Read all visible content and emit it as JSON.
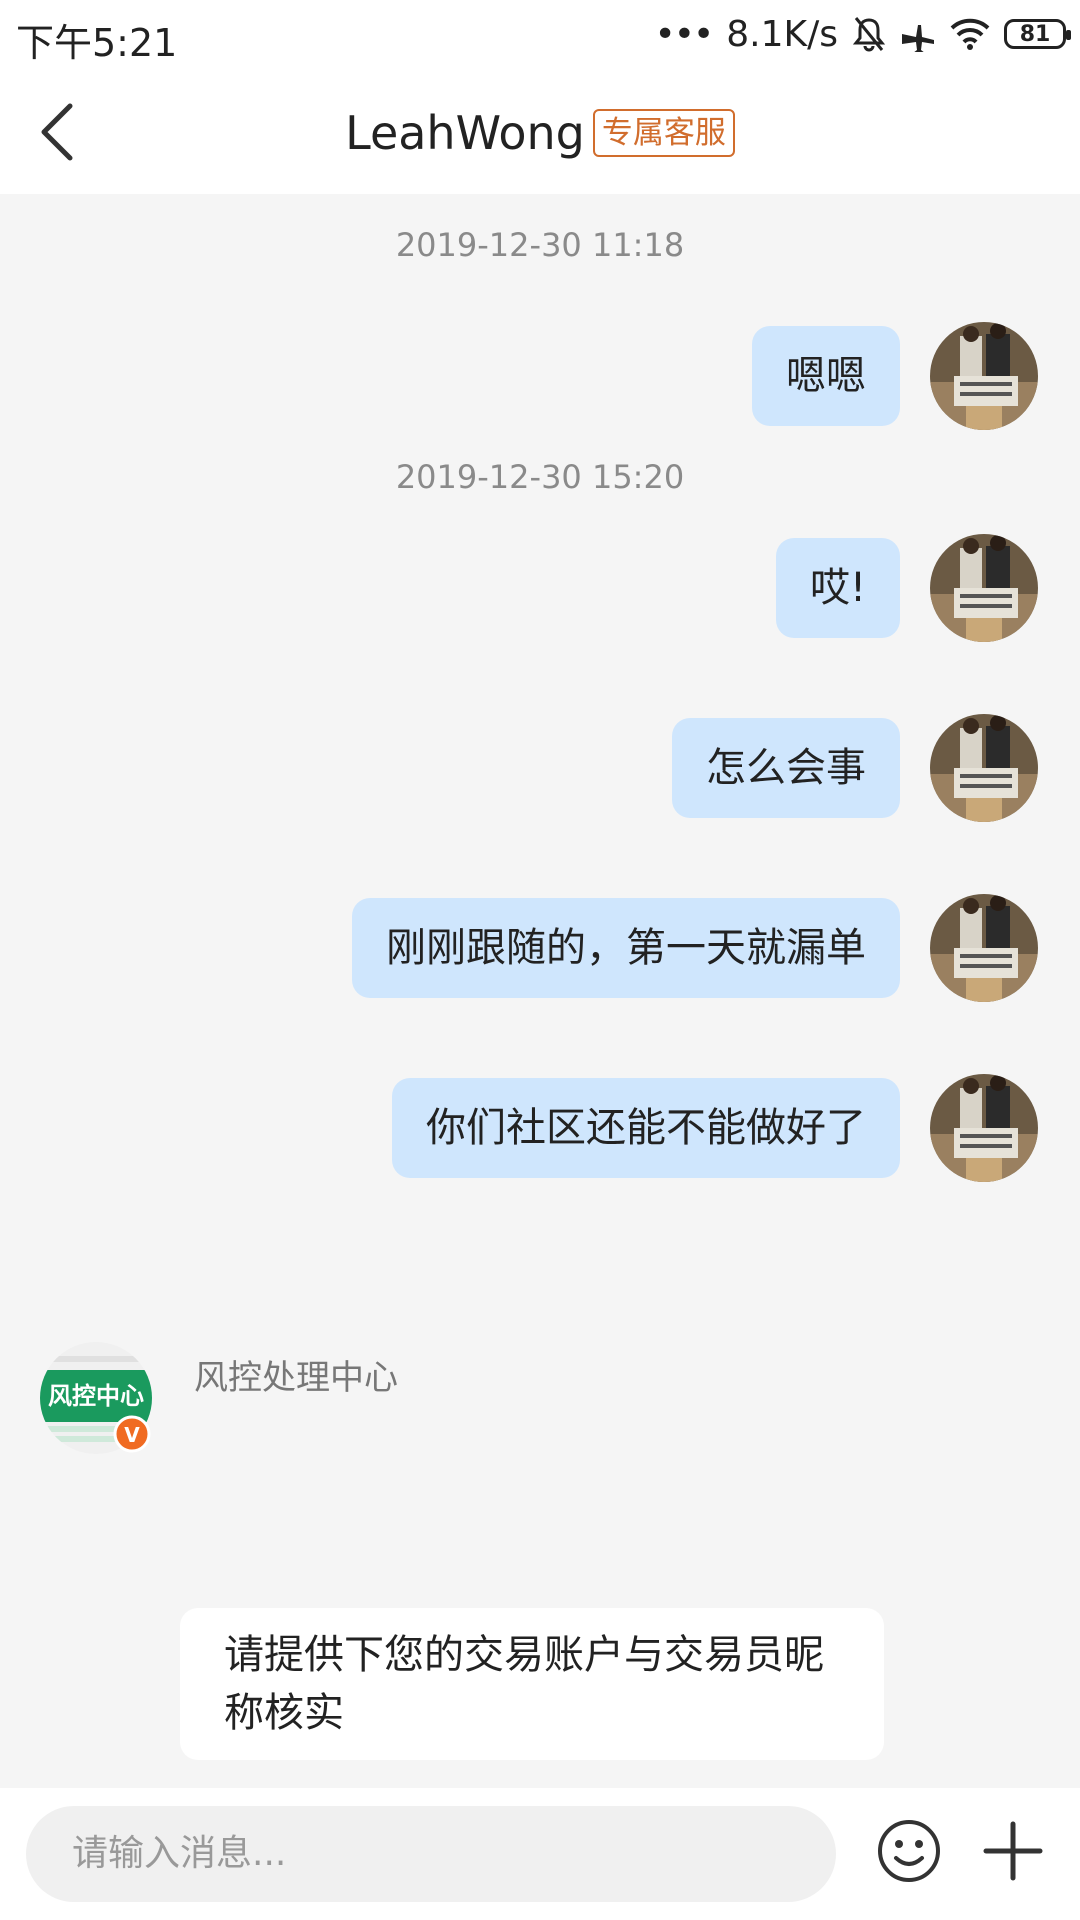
{
  "status_bar": {
    "time": "下午5:21",
    "dots": "•••",
    "network_speed": "8.1K/s",
    "battery": "81",
    "icons": [
      "mute-bell-icon",
      "airplane-icon",
      "wifi-icon",
      "battery-icon"
    ]
  },
  "header": {
    "title": "LeahWong",
    "tag": "专属客服",
    "back_icon": "chevron-left-icon"
  },
  "messages": [
    {
      "type": "timestamp",
      "text": "2019-12-30 11:18"
    },
    {
      "type": "outgoing",
      "text": "嗯嗯"
    },
    {
      "type": "timestamp",
      "text": "2019-12-30 15:20"
    },
    {
      "type": "outgoing",
      "text": "哎!"
    },
    {
      "type": "outgoing",
      "text": "怎么会事"
    },
    {
      "type": "outgoing",
      "text": "刚刚跟随的，第一天就漏单"
    },
    {
      "type": "outgoing",
      "text": "你们社区还能不能做好了"
    },
    {
      "type": "incoming",
      "sender": "风控处理中心",
      "avatar_text": "风控中心",
      "badge": "V",
      "text": "请提供下您的交易账户与交易员昵称核实"
    }
  ],
  "input_bar": {
    "placeholder": "请输入消息...",
    "emoji_icon": "smiley-icon",
    "plus_icon": "plus-icon"
  },
  "colors": {
    "outgoing_bubble": "#cfe6fd",
    "incoming_bubble": "#ffffff",
    "background": "#f5f5f5",
    "tag": "#d16d2d",
    "avatar_green": "#1a9a5e",
    "badge_orange": "#f06b22"
  }
}
